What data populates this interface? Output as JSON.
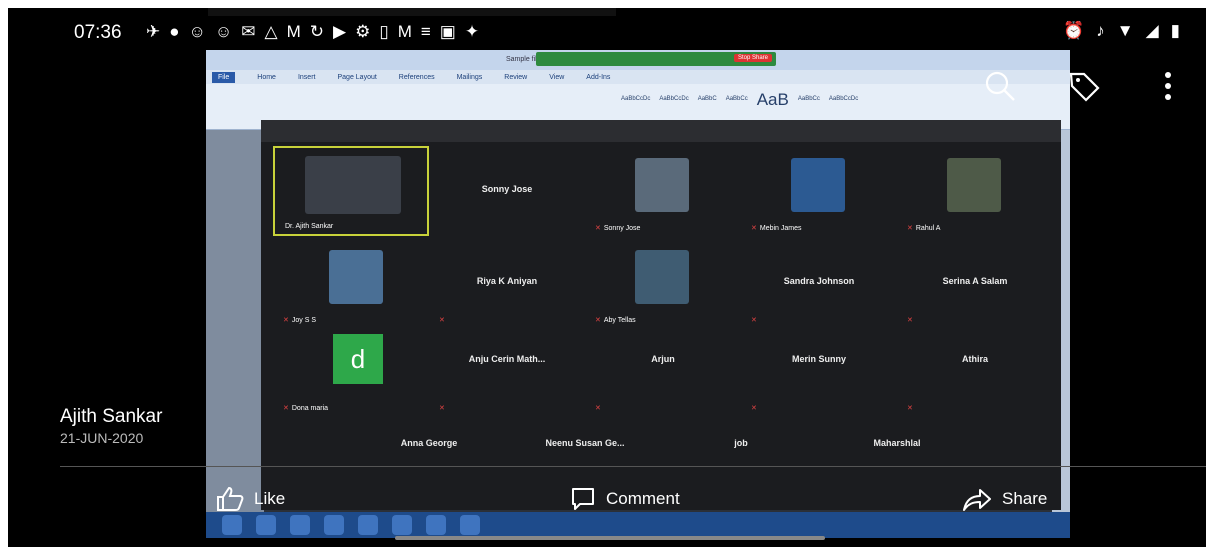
{
  "status": {
    "time": "07:36",
    "left_icons": [
      "telegram-icon",
      "message-icon",
      "person-icon",
      "person-icon",
      "mail-icon",
      "drive-icon",
      "gmail-icon",
      "sync-icon",
      "play-icon",
      "settings-icon",
      "pin-icon",
      "gmail-icon",
      "tower-icon",
      "gallery-icon",
      "satellite-icon"
    ],
    "right_icons": [
      "alarm-icon",
      "mute-icon",
      "wifi-icon",
      "signal-icon",
      "battery-icon"
    ]
  },
  "viewer": {
    "actions": [
      "search-icon",
      "tag-icon",
      "more-vertical-icon"
    ]
  },
  "photo": {
    "doc_title": "Sample fil",
    "share_stop": "Stop Share",
    "ribbon_tabs": [
      "File",
      "Home",
      "Insert",
      "Page Layout",
      "References",
      "Mailings",
      "Review",
      "View",
      "Add-Ins"
    ],
    "styles": [
      "AaBbCcDc",
      "AaBbCcDc",
      "AaBbC",
      "AaBbCc",
      "AaB",
      "AaBbCc",
      "AaBbCcDc"
    ],
    "participants": [
      {
        "name": "Dr. Ajith Sankar",
        "label": "Dr. Ajith Sankar",
        "kind": "video"
      },
      {
        "name": "Sonny Jose",
        "label": "",
        "kind": "name"
      },
      {
        "name": "",
        "label": "Sonny Jose",
        "kind": "video"
      },
      {
        "name": "",
        "label": "Mebin James",
        "kind": "video"
      },
      {
        "name": "",
        "label": "Rahul A",
        "kind": "video"
      },
      {
        "name": "",
        "label": "Joy S S",
        "kind": "video"
      },
      {
        "name": "Riya K Aniyan",
        "label": "",
        "kind": "name"
      },
      {
        "name": "",
        "label": "Aby Tellas",
        "kind": "video"
      },
      {
        "name": "Sandra Johnson",
        "label": "",
        "kind": "name"
      },
      {
        "name": "Serina A Salam",
        "label": "",
        "kind": "name"
      },
      {
        "name": "",
        "label": "Dona maria",
        "kind": "avatar"
      },
      {
        "name": "Anju Cerin Math...",
        "label": "",
        "kind": "name"
      },
      {
        "name": "Arjun",
        "label": "",
        "kind": "name"
      },
      {
        "name": "Merin Sunny",
        "label": "",
        "kind": "name"
      },
      {
        "name": "Athira",
        "label": "",
        "kind": "name"
      },
      {
        "name": "Anna George",
        "label": "",
        "kind": "name"
      },
      {
        "name": "Neenu Susan Ge...",
        "label": "",
        "kind": "name"
      },
      {
        "name": "job",
        "label": "",
        "kind": "name"
      },
      {
        "name": "Maharshlal",
        "label": "",
        "kind": "name"
      }
    ],
    "avatar_letter": "d"
  },
  "owner": {
    "name": "Ajith Sankar",
    "date": "21-JUN-2020"
  },
  "actions": {
    "like": "Like",
    "comment": "Comment",
    "share": "Share"
  }
}
